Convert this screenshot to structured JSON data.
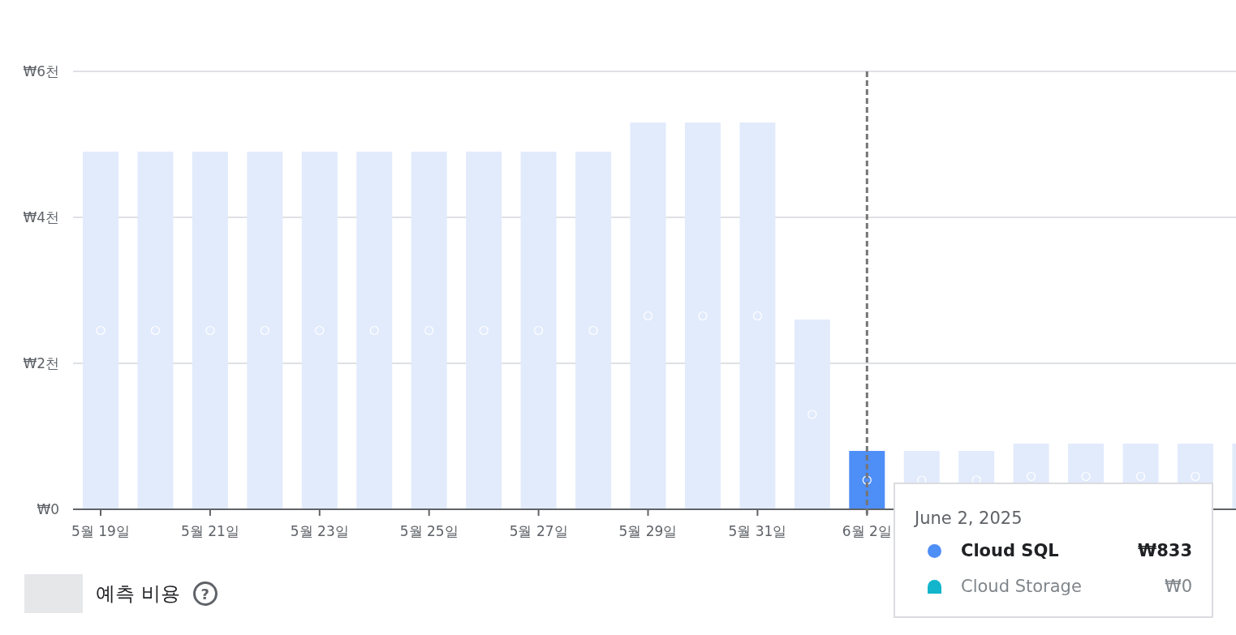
{
  "chart": {
    "chart_data": {
      "type": "bar",
      "ylim": [
        0,
        6
      ],
      "yticks": [
        {
          "value": 0,
          "label": "₩0"
        },
        {
          "value": 2,
          "label": "₩2천"
        },
        {
          "value": 4,
          "label": "₩4천"
        },
        {
          "value": 6,
          "label": "₩6천"
        }
      ],
      "categories": [
        "5월 19일",
        null,
        "5월 21일",
        null,
        "5월 23일",
        null,
        "5월 25일",
        null,
        "5월 27일",
        null,
        "5월 29일",
        null,
        "5월 31일",
        null,
        "6월 2일",
        null,
        null,
        null,
        null,
        null,
        null,
        null
      ],
      "values": [
        4.9,
        4.9,
        4.9,
        4.9,
        4.9,
        4.9,
        4.9,
        4.9,
        4.9,
        4.9,
        5.3,
        5.3,
        5.3,
        2.6,
        0.8,
        0.8,
        0.8,
        0.9,
        0.9,
        0.9,
        0.9,
        0.9
      ],
      "annotations": [
        {
          "x": "6월 2일"
        }
      ]
    }
  },
  "tooltip": {
    "date": "June 2, 2025",
    "rows": [
      {
        "name": "Cloud SQL",
        "value": "₩833",
        "color": "#4e8ef7",
        "kind": "circle",
        "highlighted": true
      },
      {
        "name": "Cloud Storage",
        "value": "₩0",
        "color": "#12b5cb",
        "kind": "arch",
        "highlighted": false
      }
    ]
  },
  "legend": {
    "label": "예측 비용",
    "help": "?"
  }
}
